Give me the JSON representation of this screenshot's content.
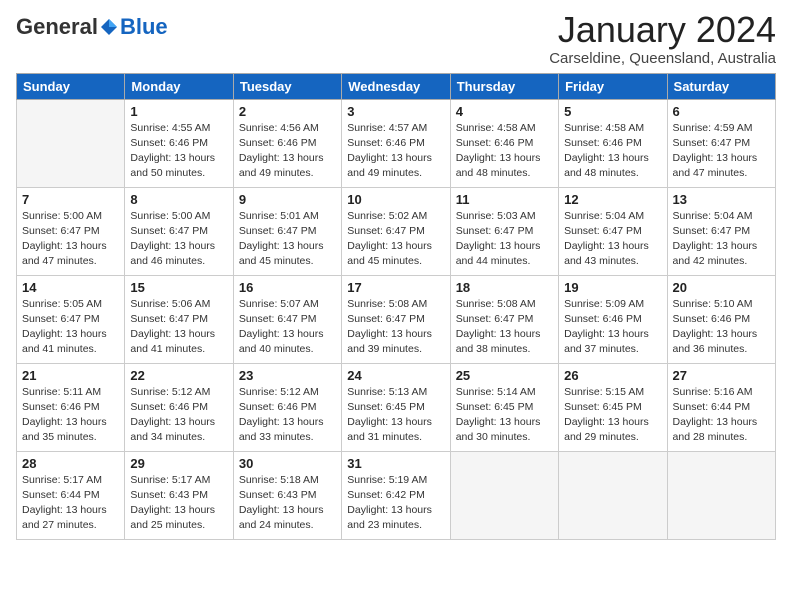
{
  "logo": {
    "general": "General",
    "blue": "Blue"
  },
  "title": "January 2024",
  "location": "Carseldine, Queensland, Australia",
  "days_header": [
    "Sunday",
    "Monday",
    "Tuesday",
    "Wednesday",
    "Thursday",
    "Friday",
    "Saturday"
  ],
  "weeks": [
    [
      {
        "day": "",
        "info": ""
      },
      {
        "day": "1",
        "info": "Sunrise: 4:55 AM\nSunset: 6:46 PM\nDaylight: 13 hours\nand 50 minutes."
      },
      {
        "day": "2",
        "info": "Sunrise: 4:56 AM\nSunset: 6:46 PM\nDaylight: 13 hours\nand 49 minutes."
      },
      {
        "day": "3",
        "info": "Sunrise: 4:57 AM\nSunset: 6:46 PM\nDaylight: 13 hours\nand 49 minutes."
      },
      {
        "day": "4",
        "info": "Sunrise: 4:58 AM\nSunset: 6:46 PM\nDaylight: 13 hours\nand 48 minutes."
      },
      {
        "day": "5",
        "info": "Sunrise: 4:58 AM\nSunset: 6:46 PM\nDaylight: 13 hours\nand 48 minutes."
      },
      {
        "day": "6",
        "info": "Sunrise: 4:59 AM\nSunset: 6:47 PM\nDaylight: 13 hours\nand 47 minutes."
      }
    ],
    [
      {
        "day": "7",
        "info": "Sunrise: 5:00 AM\nSunset: 6:47 PM\nDaylight: 13 hours\nand 47 minutes."
      },
      {
        "day": "8",
        "info": "Sunrise: 5:00 AM\nSunset: 6:47 PM\nDaylight: 13 hours\nand 46 minutes."
      },
      {
        "day": "9",
        "info": "Sunrise: 5:01 AM\nSunset: 6:47 PM\nDaylight: 13 hours\nand 45 minutes."
      },
      {
        "day": "10",
        "info": "Sunrise: 5:02 AM\nSunset: 6:47 PM\nDaylight: 13 hours\nand 45 minutes."
      },
      {
        "day": "11",
        "info": "Sunrise: 5:03 AM\nSunset: 6:47 PM\nDaylight: 13 hours\nand 44 minutes."
      },
      {
        "day": "12",
        "info": "Sunrise: 5:04 AM\nSunset: 6:47 PM\nDaylight: 13 hours\nand 43 minutes."
      },
      {
        "day": "13",
        "info": "Sunrise: 5:04 AM\nSunset: 6:47 PM\nDaylight: 13 hours\nand 42 minutes."
      }
    ],
    [
      {
        "day": "14",
        "info": "Sunrise: 5:05 AM\nSunset: 6:47 PM\nDaylight: 13 hours\nand 41 minutes."
      },
      {
        "day": "15",
        "info": "Sunrise: 5:06 AM\nSunset: 6:47 PM\nDaylight: 13 hours\nand 41 minutes."
      },
      {
        "day": "16",
        "info": "Sunrise: 5:07 AM\nSunset: 6:47 PM\nDaylight: 13 hours\nand 40 minutes."
      },
      {
        "day": "17",
        "info": "Sunrise: 5:08 AM\nSunset: 6:47 PM\nDaylight: 13 hours\nand 39 minutes."
      },
      {
        "day": "18",
        "info": "Sunrise: 5:08 AM\nSunset: 6:47 PM\nDaylight: 13 hours\nand 38 minutes."
      },
      {
        "day": "19",
        "info": "Sunrise: 5:09 AM\nSunset: 6:46 PM\nDaylight: 13 hours\nand 37 minutes."
      },
      {
        "day": "20",
        "info": "Sunrise: 5:10 AM\nSunset: 6:46 PM\nDaylight: 13 hours\nand 36 minutes."
      }
    ],
    [
      {
        "day": "21",
        "info": "Sunrise: 5:11 AM\nSunset: 6:46 PM\nDaylight: 13 hours\nand 35 minutes."
      },
      {
        "day": "22",
        "info": "Sunrise: 5:12 AM\nSunset: 6:46 PM\nDaylight: 13 hours\nand 34 minutes."
      },
      {
        "day": "23",
        "info": "Sunrise: 5:12 AM\nSunset: 6:46 PM\nDaylight: 13 hours\nand 33 minutes."
      },
      {
        "day": "24",
        "info": "Sunrise: 5:13 AM\nSunset: 6:45 PM\nDaylight: 13 hours\nand 31 minutes."
      },
      {
        "day": "25",
        "info": "Sunrise: 5:14 AM\nSunset: 6:45 PM\nDaylight: 13 hours\nand 30 minutes."
      },
      {
        "day": "26",
        "info": "Sunrise: 5:15 AM\nSunset: 6:45 PM\nDaylight: 13 hours\nand 29 minutes."
      },
      {
        "day": "27",
        "info": "Sunrise: 5:16 AM\nSunset: 6:44 PM\nDaylight: 13 hours\nand 28 minutes."
      }
    ],
    [
      {
        "day": "28",
        "info": "Sunrise: 5:17 AM\nSunset: 6:44 PM\nDaylight: 13 hours\nand 27 minutes."
      },
      {
        "day": "29",
        "info": "Sunrise: 5:17 AM\nSunset: 6:43 PM\nDaylight: 13 hours\nand 25 minutes."
      },
      {
        "day": "30",
        "info": "Sunrise: 5:18 AM\nSunset: 6:43 PM\nDaylight: 13 hours\nand 24 minutes."
      },
      {
        "day": "31",
        "info": "Sunrise: 5:19 AM\nSunset: 6:42 PM\nDaylight: 13 hours\nand 23 minutes."
      },
      {
        "day": "",
        "info": ""
      },
      {
        "day": "",
        "info": ""
      },
      {
        "day": "",
        "info": ""
      }
    ]
  ]
}
